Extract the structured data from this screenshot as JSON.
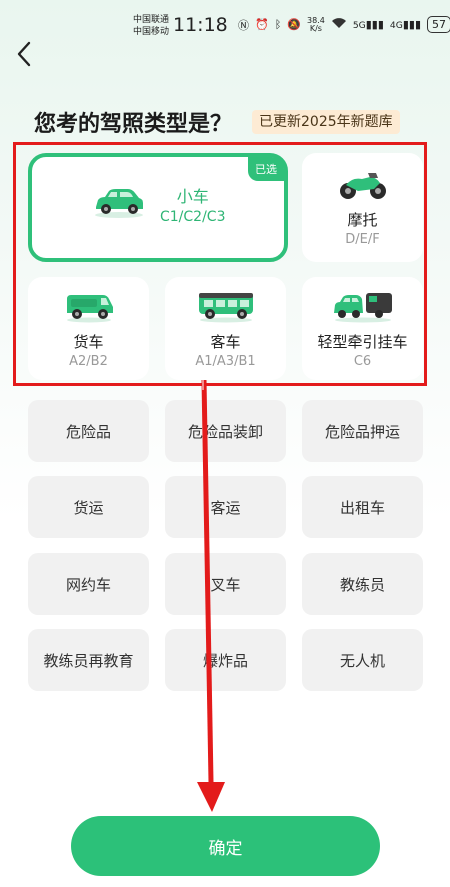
{
  "status_bar": {
    "carrier_1": "中国联通",
    "carrier_2": "中国移动",
    "time": "11:18",
    "speed_value": "38.4",
    "speed_unit": "K/s",
    "net_1": "5G",
    "net_2": "4G",
    "battery": "57"
  },
  "header": {
    "back_icon": "chevron-left-icon",
    "title": "您考的驾照类型是？",
    "badge": "已更新2025年新题库"
  },
  "vehicles": [
    {
      "name": "小车",
      "sub": "C1/C2/C3",
      "selected": true,
      "tag": "已选",
      "icon": "car-icon"
    },
    {
      "name": "摩托",
      "sub": "D/E/F",
      "icon": "motorcycle-icon"
    },
    {
      "name": "货车",
      "sub": "A2/B2",
      "icon": "truck-icon"
    },
    {
      "name": "客车",
      "sub": "A1/A3/B1",
      "icon": "bus-icon"
    },
    {
      "name": "轻型牵引挂车",
      "sub": "C6",
      "icon": "trailer-icon"
    }
  ],
  "categories": [
    "危险品",
    "危险品装卸",
    "危险品押运",
    "货运",
    "客运",
    "出租车",
    "网约车",
    "叉车",
    "教练员",
    "教练员再教育",
    "爆炸品",
    "无人机"
  ],
  "confirm_label": "确定",
  "colors": {
    "accent": "#2cc179",
    "annotation": "#e31b1b"
  }
}
